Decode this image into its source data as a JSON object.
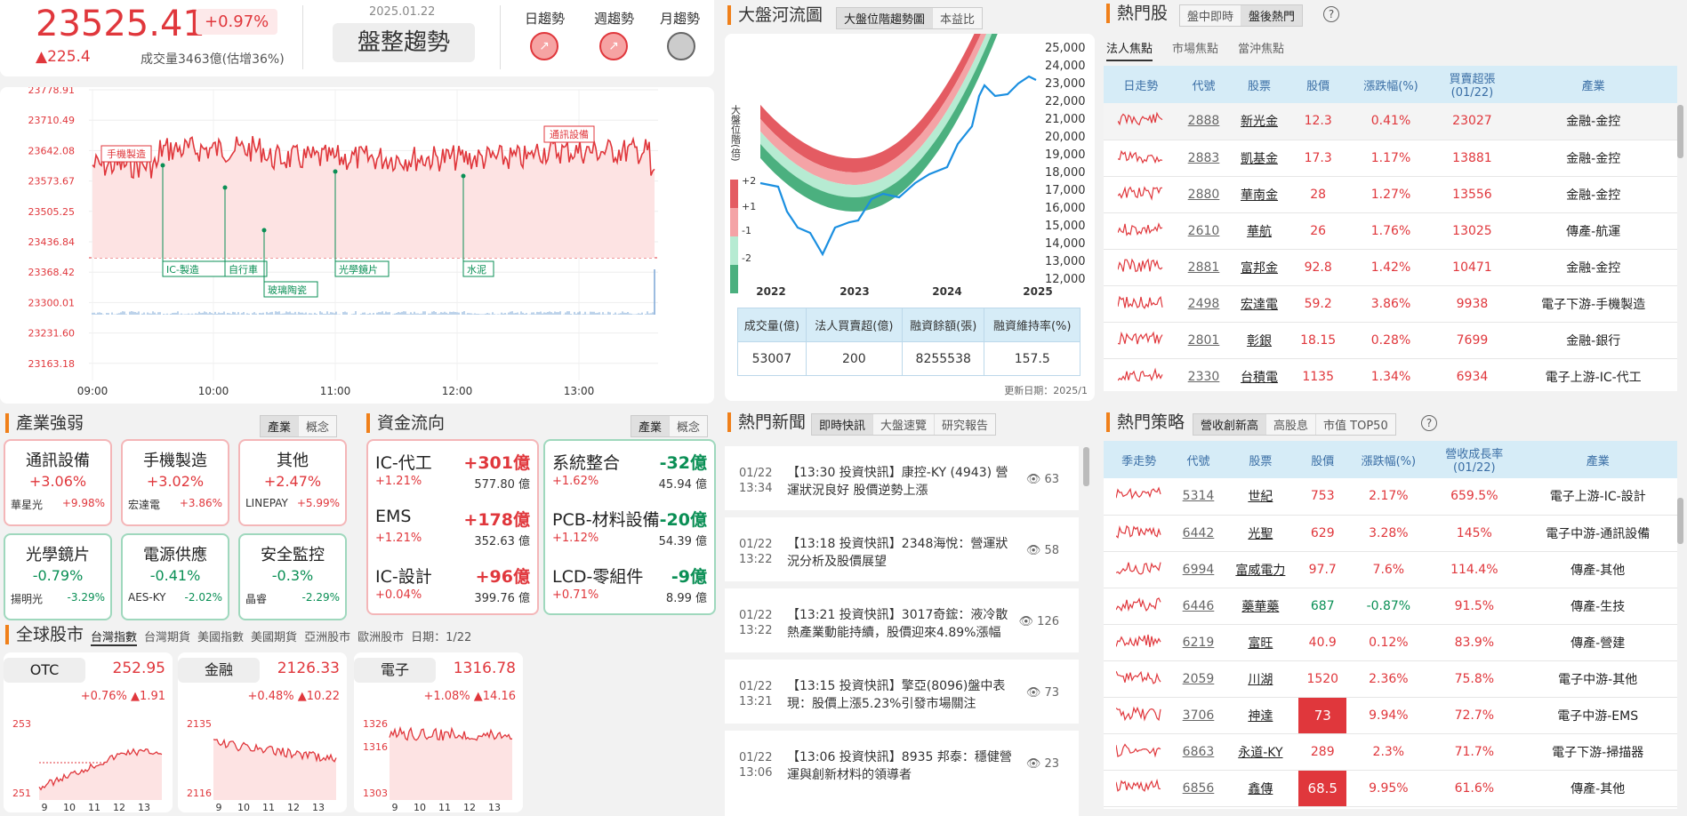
{
  "colors": {
    "up": "#e0373c",
    "down": "#0a8f55",
    "accent": "#f0801a",
    "header_bg": "#d6ecf7"
  },
  "index": {
    "value": "23525.41",
    "pct": "+0.97%",
    "change": "▲225.4",
    "volume": "成交量3463億(估增36%)",
    "date": "2025.01.22",
    "trend": "盤整趨勢"
  },
  "trends": {
    "day": "日趨勢",
    "week": "週趨勢",
    "month": "月趨勢"
  },
  "intraday": {
    "yticks": [
      "23778.91",
      "23710.49",
      "23642.08",
      "23573.67",
      "23505.25",
      "23436.84",
      "23368.42",
      "23300.01",
      "23231.60",
      "23163.18"
    ],
    "xticks": [
      "09:00",
      "10:00",
      "11:00",
      "12:00",
      "13:00"
    ],
    "tags_top": [
      "手機製造",
      "通訊設備"
    ],
    "tags_bottom": [
      "IC-製造",
      "自行車",
      "玻璃陶瓷",
      "光學鏡片",
      "水泥"
    ]
  },
  "river": {
    "title": "大盤河流圖",
    "tabs": [
      "大盤位階趨勢圖",
      "本益比"
    ],
    "yaxis_label": "大盤位階(倍)",
    "levels": [
      "+2",
      "+1",
      "-1",
      "-2"
    ],
    "yticks": [
      "25,000",
      "24,000",
      "23,000",
      "22,000",
      "21,000",
      "20,000",
      "19,000",
      "18,000",
      "17,000",
      "16,000",
      "15,000",
      "14,000",
      "13,000",
      "12,000"
    ],
    "xticks": [
      "2022",
      "2023",
      "2024",
      "2025"
    ],
    "table_headers": [
      "成交量(億)",
      "法人買賣超(億)",
      "融資餘額(張)",
      "融資維持率(%)"
    ],
    "table_values": [
      "53007",
      "200",
      "8255538",
      "157.5"
    ],
    "update": "更新日期：2025/1"
  },
  "hot": {
    "title": "熱門股",
    "tabs": [
      "盤中即時",
      "盤後熱門"
    ],
    "help": "?",
    "subtabs": [
      "法人焦點",
      "市場焦點",
      "當沖焦點"
    ],
    "headers": [
      "日走勢",
      "代號",
      "股票",
      "股價",
      "漲跌幅(%)",
      "買賣超張\n(01/22)",
      "產業"
    ],
    "rows": [
      [
        "2888",
        "新光金",
        "12.3",
        "0.41%",
        "23027",
        "金融-金控"
      ],
      [
        "2883",
        "凱基金",
        "17.3",
        "1.17%",
        "13881",
        "金融-金控"
      ],
      [
        "2880",
        "華南金",
        "28",
        "1.27%",
        "13556",
        "金融-金控"
      ],
      [
        "2610",
        "華航",
        "26",
        "1.76%",
        "13025",
        "傳產-航運"
      ],
      [
        "2881",
        "富邦金",
        "92.8",
        "1.42%",
        "10471",
        "金融-金控"
      ],
      [
        "2498",
        "宏達電",
        "59.2",
        "3.86%",
        "9938",
        "電子下游-手機製造"
      ],
      [
        "2801",
        "彰銀",
        "18.15",
        "0.28%",
        "7699",
        "金融-銀行"
      ],
      [
        "2330",
        "台積電",
        "1135",
        "1.34%",
        "6934",
        "電子上游-IC-代工"
      ]
    ]
  },
  "industry": {
    "title": "產業強弱",
    "tabs": [
      "產業",
      "概念"
    ],
    "boxes": [
      {
        "name": "通訊設備",
        "pct": "+3.06%",
        "stock": "華星光",
        "spct": "+9.98%",
        "dir": "up"
      },
      {
        "name": "手機製造",
        "pct": "+3.02%",
        "stock": "宏達電",
        "spct": "+3.86%",
        "dir": "up"
      },
      {
        "name": "其他",
        "pct": "+2.47%",
        "stock": "LINEPAY",
        "spct": "+5.99%",
        "dir": "up"
      },
      {
        "name": "光學鏡片",
        "pct": "-0.79%",
        "stock": "揚明光",
        "spct": "-3.29%",
        "dir": "dn"
      },
      {
        "name": "電源供應",
        "pct": "-0.41%",
        "stock": "AES-KY",
        "spct": "-2.02%",
        "dir": "dn"
      },
      {
        "name": "安全監控",
        "pct": "-0.3%",
        "stock": "晶睿",
        "spct": "-2.29%",
        "dir": "dn"
      }
    ]
  },
  "fund": {
    "title": "資金流向",
    "tabs": [
      "產業",
      "概念"
    ],
    "up": [
      {
        "name": "IC-代工",
        "val": "+301億",
        "pct": "+1.21%",
        "amt": "577.80 億"
      },
      {
        "name": "EMS",
        "val": "+178億",
        "pct": "+1.21%",
        "amt": "352.63 億"
      },
      {
        "name": "IC-設計",
        "val": "+96億",
        "pct": "+0.04%",
        "amt": "399.76 億"
      }
    ],
    "down": [
      {
        "name": "系統整合",
        "val": "-32億",
        "pct": "+1.62%",
        "amt": "45.94 億"
      },
      {
        "name": "PCB-材料設備",
        "val": "-20億",
        "pct": "+1.12%",
        "amt": "54.39 億"
      },
      {
        "name": "LCD-零組件",
        "val": "-9億",
        "pct": "+0.71%",
        "amt": "8.99 億"
      }
    ]
  },
  "global": {
    "title": "全球股市",
    "tabs": [
      "台灣指數",
      "台灣期貨",
      "美國指數",
      "美國期貨",
      "亞洲股市",
      "歐洲股市"
    ],
    "date": "日期：1/22",
    "cards": [
      {
        "name": "OTC",
        "price": "252.95",
        "pct": "+0.76%",
        "chg": "▲1.91",
        "hi": "253",
        "lo": "251"
      },
      {
        "name": "金融",
        "price": "2126.33",
        "pct": "+0.48%",
        "chg": "▲10.22",
        "hi": "2135",
        "lo": "2116"
      },
      {
        "name": "電子",
        "price": "1316.78",
        "pct": "+1.08%",
        "chg": "▲14.16",
        "hi": "1326",
        "mid": "1316",
        "lo": "1303"
      }
    ],
    "xticks": [
      "9",
      "10",
      "11",
      "12",
      "13"
    ]
  },
  "news": {
    "title": "熱門新聞",
    "tabs": [
      "即時快訊",
      "大盤速覽",
      "研究報告"
    ],
    "items": [
      {
        "date": "01/22",
        "time": "13:34",
        "title": "【13:30 投資快訊】康控-KY (4943) 營運狀況良好 股價逆勢上漲",
        "views": "63"
      },
      {
        "date": "01/22",
        "time": "13:22",
        "title": "【13:18 投資快訊】2348海悅：營運狀況分析及股價展望",
        "views": "58"
      },
      {
        "date": "01/22",
        "time": "13:22",
        "title": "【13:21 投資快訊】3017奇鋐：液冷散熱產業動能持續，股價迎來4.89%漲幅",
        "views": "126"
      },
      {
        "date": "01/22",
        "time": "13:21",
        "title": "【13:15 投資快訊】擎亞(8096)盤中表現：股價上漲5.23%引發市場關注",
        "views": "73"
      },
      {
        "date": "01/22",
        "time": "13:06",
        "title": "【13:06 投資快訊】8935 邦泰：穩健營運與創新材料的領導者",
        "views": "23"
      }
    ]
  },
  "strategy": {
    "title": "熱門策略",
    "tabs": [
      "營收創新高",
      "高股息",
      "市值 TOP50"
    ],
    "help": "?",
    "headers": [
      "季走勢",
      "代號",
      "股票",
      "股價",
      "漲跌幅(%)",
      "營收成長率\n(01/22)",
      "產業"
    ],
    "rows": [
      [
        "5314",
        "世紀",
        "753",
        "2.17%",
        "659.5%",
        "電子上游-IC-設計",
        "up"
      ],
      [
        "6442",
        "光聖",
        "629",
        "3.28%",
        "145%",
        "電子中游-通訊設備",
        "up"
      ],
      [
        "6994",
        "富威電力",
        "97.7",
        "7.6%",
        "114.4%",
        "傳產-其他",
        "up"
      ],
      [
        "6446",
        "藥華藥",
        "687",
        "-0.87%",
        "91.5%",
        "傳產-生技",
        "dn"
      ],
      [
        "6219",
        "富旺",
        "40.9",
        "0.12%",
        "83.9%",
        "傳產-營建",
        "up"
      ],
      [
        "2059",
        "川湖",
        "1520",
        "2.36%",
        "75.8%",
        "電子中游-其他",
        "up"
      ],
      [
        "3706",
        "神達",
        "73",
        "9.94%",
        "72.7%",
        "電子中游-EMS",
        "lim"
      ],
      [
        "6863",
        "永道-KY",
        "289",
        "2.3%",
        "71.7%",
        "電子下游-掃描器",
        "up"
      ],
      [
        "6856",
        "鑫傳",
        "68.5",
        "9.95%",
        "61.6%",
        "傳產-其他",
        "lim"
      ]
    ]
  }
}
